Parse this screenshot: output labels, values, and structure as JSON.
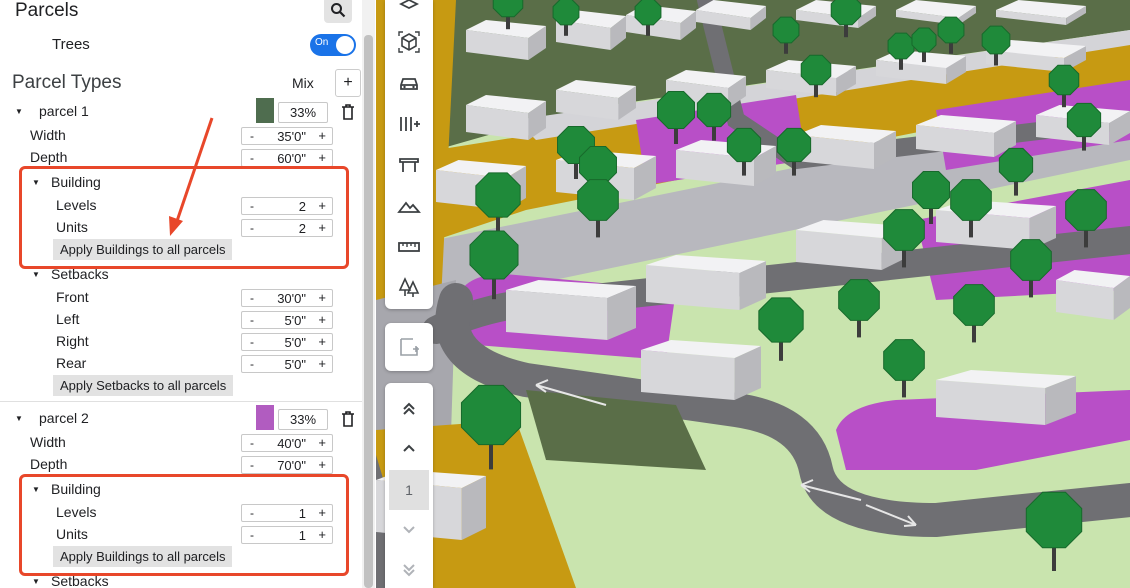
{
  "panel": {
    "title": "Parcels",
    "trees_label": "Trees",
    "trees_toggle": "On",
    "types_heading": "Parcel Types",
    "mix_label": "Mix",
    "add_label": "+"
  },
  "stepper": {
    "minus": "-",
    "plus": "+"
  },
  "parcels": [
    {
      "name": "parcel 1",
      "color": "#4f6d4f",
      "mix": "33%",
      "width_label": "Width",
      "width": "35'0\"",
      "depth_label": "Depth",
      "depth": "60'0\"",
      "building_label": "Building",
      "levels_label": "Levels",
      "levels": "2",
      "units_label": "Units",
      "units": "2",
      "apply_buildings": "Apply Buildings to all parcels",
      "setbacks_label": "Setbacks",
      "front_label": "Front",
      "front": "30'0\"",
      "left_label": "Left",
      "left": "5'0\"",
      "right_label": "Right",
      "right": "5'0\"",
      "rear_label": "Rear",
      "rear": "5'0\"",
      "apply_setbacks": "Apply Setbacks to all parcels"
    },
    {
      "name": "parcel 2",
      "color": "#b15cc0",
      "mix": "33%",
      "width_label": "Width",
      "width": "40'0\"",
      "depth_label": "Depth",
      "depth": "70'0\"",
      "building_label": "Building",
      "levels_label": "Levels",
      "levels": "1",
      "units_label": "Units",
      "units": "1",
      "apply_buildings": "Apply Buildings to all parcels",
      "setbacks_label": "Setbacks"
    }
  ],
  "pager": {
    "page": "1"
  },
  "colors": {
    "annotation": "#e8472a",
    "accent": "#1a73e8",
    "road": "#6f6f73",
    "grass": "#c9e4ae",
    "lot_purple": "#b84fc7",
    "lot_mustard": "#c79a12",
    "lot_olive": "#5a6e48",
    "tree": "#1f8a3a"
  },
  "icons": [
    "search-icon",
    "layers-icon",
    "cube-icon",
    "car-icon",
    "spacing-icon",
    "fence-icon",
    "terrain-icon",
    "ruler-icon",
    "trees-icon",
    "add-box-icon",
    "double-chevron-up-icon",
    "chevron-up-icon",
    "chevron-down-icon",
    "double-chevron-down-icon",
    "trash-icon"
  ]
}
